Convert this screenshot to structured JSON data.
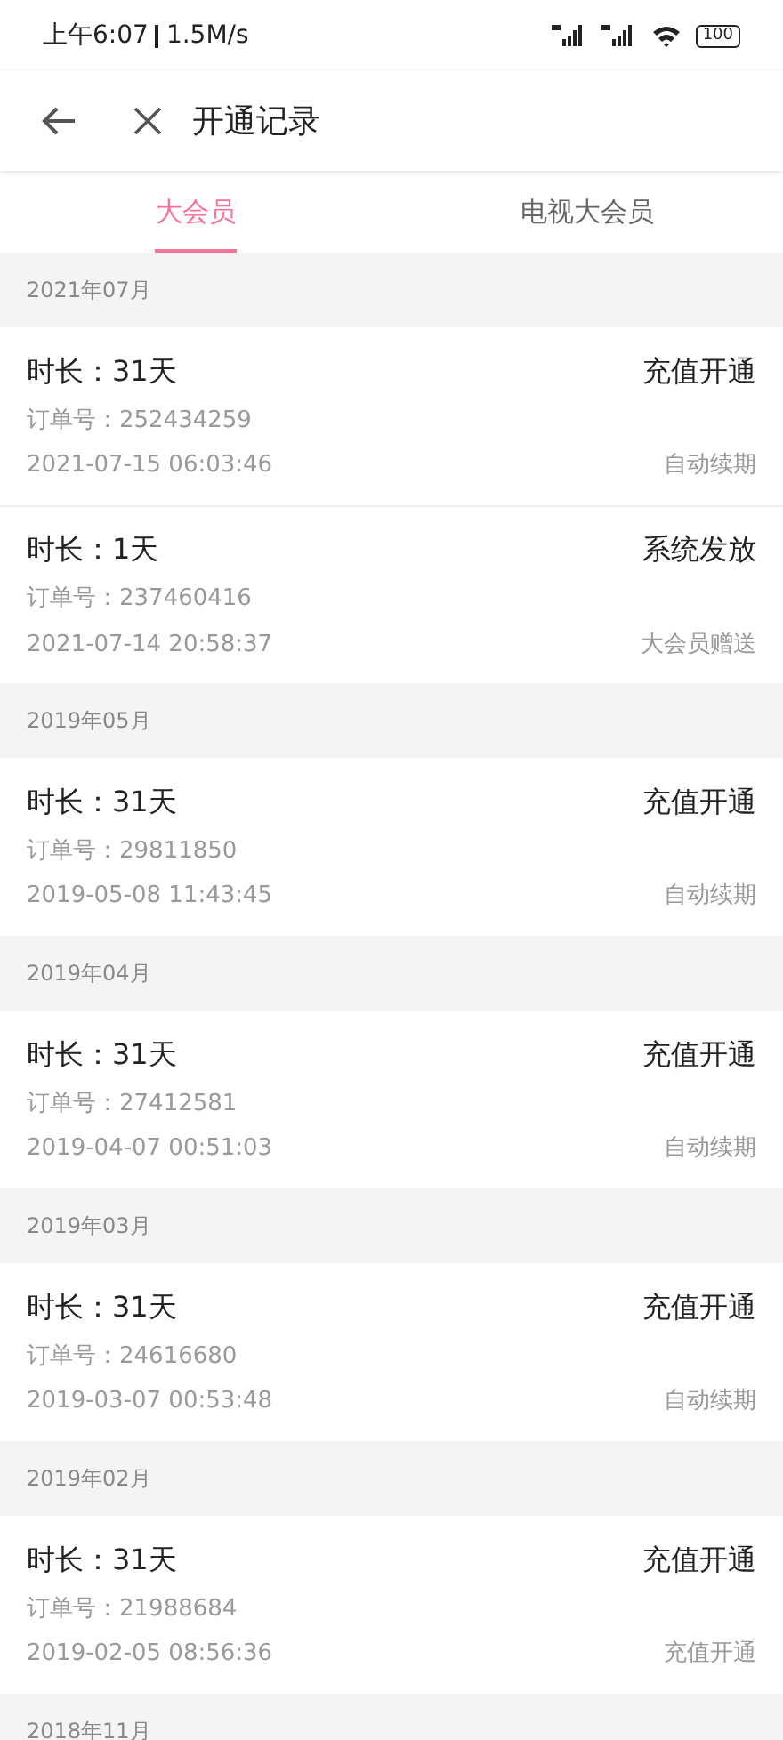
{
  "status_bar": {
    "time": "上午6:07",
    "speed": "1.5M/s",
    "battery": "100"
  },
  "toolbar": {
    "title": "开通记录"
  },
  "tabs": [
    {
      "label": "大会员",
      "selected": true
    },
    {
      "label": "电视大会员",
      "selected": false
    }
  ],
  "sections": [
    {
      "month": "2021年07月",
      "records": [
        {
          "duration": "时长：31天",
          "type": "充值开通",
          "order": "订单号：252434259",
          "time": "2021-07-15 06:03:46",
          "source": "自动续期"
        },
        {
          "duration": "时长：1天",
          "type": "系统发放",
          "order": "订单号：237460416",
          "time": "2021-07-14 20:58:37",
          "source": "大会员赠送"
        }
      ]
    },
    {
      "month": "2019年05月",
      "records": [
        {
          "duration": "时长：31天",
          "type": "充值开通",
          "order": "订单号：29811850",
          "time": "2019-05-08 11:43:45",
          "source": "自动续期"
        }
      ]
    },
    {
      "month": "2019年04月",
      "records": [
        {
          "duration": "时长：31天",
          "type": "充值开通",
          "order": "订单号：27412581",
          "time": "2019-04-07 00:51:03",
          "source": "自动续期"
        }
      ]
    },
    {
      "month": "2019年03月",
      "records": [
        {
          "duration": "时长：31天",
          "type": "充值开通",
          "order": "订单号：24616680",
          "time": "2019-03-07 00:53:48",
          "source": "自动续期"
        }
      ]
    },
    {
      "month": "2019年02月",
      "records": [
        {
          "duration": "时长：31天",
          "type": "充值开通",
          "order": "订单号：21988684",
          "time": "2019-02-05 08:56:36",
          "source": "充值开通"
        }
      ]
    },
    {
      "month": "2018年11月"
    }
  ]
}
